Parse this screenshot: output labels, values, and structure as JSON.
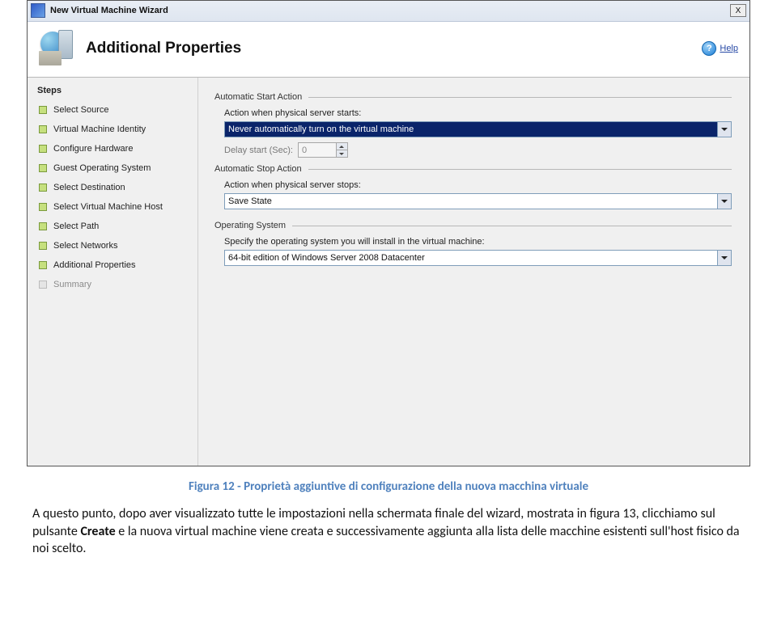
{
  "window": {
    "title": "New Virtual Machine Wizard",
    "close": "X"
  },
  "banner": {
    "title": "Additional Properties",
    "help": "Help",
    "help_q": "?"
  },
  "steps": {
    "header": "Steps",
    "items": [
      {
        "label": "Select Source"
      },
      {
        "label": "Virtual Machine Identity"
      },
      {
        "label": "Configure Hardware"
      },
      {
        "label": "Guest Operating System"
      },
      {
        "label": "Select Destination"
      },
      {
        "label": "Select Virtual Machine Host"
      },
      {
        "label": "Select Path"
      },
      {
        "label": "Select Networks"
      },
      {
        "label": "Additional Properties"
      }
    ],
    "future": {
      "label": "Summary"
    }
  },
  "groups": {
    "auto_start": {
      "title": "Automatic Start Action",
      "action_label": "Action when physical server starts:",
      "action_value": "Never automatically turn on the virtual machine",
      "delay_label": "Delay start (Sec):",
      "delay_value": "0"
    },
    "auto_stop": {
      "title": "Automatic Stop Action",
      "action_label": "Action when physical server stops:",
      "action_value": "Save State"
    },
    "os": {
      "title": "Operating System",
      "specify_label": "Specify the operating system you will install in the virtual machine:",
      "value": "64-bit edition of Windows Server 2008 Datacenter"
    }
  },
  "caption": "Figura 12 - Proprietà aggiuntive di configurazione della nuova macchina virtuale",
  "description_pre": "A questo punto, dopo aver visualizzato tutte le impostazioni nella schermata finale del wizard, mostrata in figura 13, clicchiamo sul pulsante ",
  "description_bold": "Create",
  "description_post": " e la nuova virtual machine viene creata e successivamente aggiunta alla lista delle macchine esistenti sull'host fisico da noi scelto."
}
